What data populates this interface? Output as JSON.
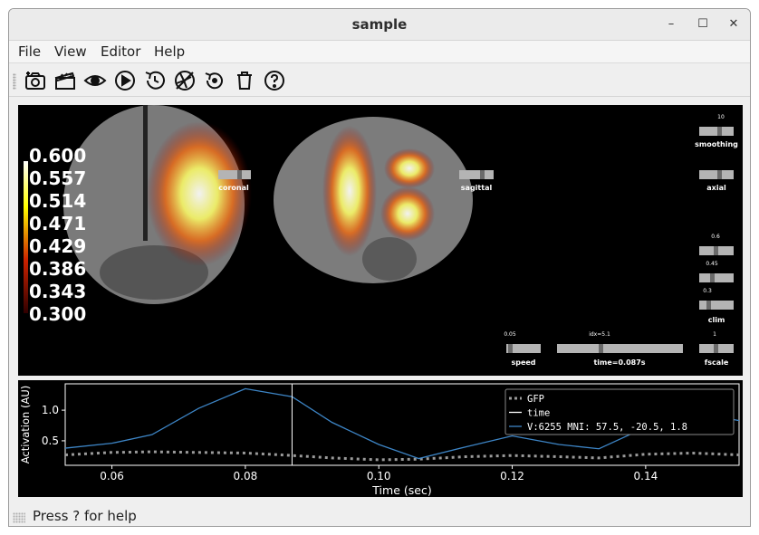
{
  "window": {
    "title": "sample",
    "controls": [
      "–",
      "☐",
      "✕"
    ]
  },
  "menubar": {
    "items": [
      "File",
      "View",
      "Editor",
      "Help"
    ]
  },
  "toolbar": {
    "icons": [
      "screenshot-icon",
      "movie-icon",
      "visibility-icon",
      "play-icon",
      "reset-time-icon",
      "camera-off-icon",
      "restore-icon",
      "trash-icon",
      "help-icon"
    ]
  },
  "colorbar": {
    "labels": [
      "0.600",
      "0.557",
      "0.514",
      "0.471",
      "0.429",
      "0.386",
      "0.343",
      "0.300"
    ]
  },
  "sliders": {
    "coronal": {
      "title": "coronal"
    },
    "sagittal": {
      "title": "sagittal"
    },
    "smoothing": {
      "title": "smoothing",
      "value": "10"
    },
    "axial": {
      "title": "axial"
    },
    "clim": {
      "title": "clim",
      "values": [
        "0.6",
        "0.45",
        "0.3"
      ]
    },
    "speed": {
      "title": "speed",
      "value": "0.05"
    },
    "time": {
      "title": "time=0.087s",
      "value": "idx=5.1"
    },
    "fscale": {
      "title": "fscale",
      "value": "1"
    }
  },
  "chart_data": {
    "type": "line",
    "xlabel": "Time (sec)",
    "ylabel": "Activation (AU)",
    "xlim": [
      0.053,
      0.154
    ],
    "ylim": [
      0.1,
      1.43
    ],
    "xticks": [
      "0.06",
      "0.08",
      "0.10",
      "0.12",
      "0.14"
    ],
    "yticks": [
      "0.5",
      "1.0"
    ],
    "time_marker": 0.087,
    "legend": {
      "placement": "top-right",
      "entries": [
        "GFP",
        "time",
        "V:6255   MNI:  57.5, -20.5,   1.8"
      ]
    },
    "series": [
      {
        "name": "GFP",
        "x": [
          0.053,
          0.06,
          0.066,
          0.073,
          0.08,
          0.087,
          0.093,
          0.1,
          0.106,
          0.113,
          0.12,
          0.127,
          0.133,
          0.14,
          0.147,
          0.154
        ],
        "values": [
          0.27,
          0.31,
          0.32,
          0.31,
          0.3,
          0.26,
          0.22,
          0.19,
          0.2,
          0.24,
          0.26,
          0.24,
          0.22,
          0.28,
          0.3,
          0.27
        ]
      },
      {
        "name": "V:6255   MNI:  57.5, -20.5,   1.8",
        "x": [
          0.053,
          0.06,
          0.066,
          0.073,
          0.08,
          0.087,
          0.093,
          0.1,
          0.106,
          0.113,
          0.12,
          0.127,
          0.133,
          0.14,
          0.147,
          0.154
        ],
        "values": [
          0.38,
          0.46,
          0.6,
          1.03,
          1.35,
          1.22,
          0.8,
          0.44,
          0.21,
          0.4,
          0.58,
          0.44,
          0.37,
          0.72,
          0.97,
          0.83
        ]
      }
    ]
  },
  "status": {
    "text": "Press ? for help"
  },
  "colors": {
    "line": "#3d85c6",
    "gfp": "#9a9a9a",
    "background": "#000000"
  }
}
